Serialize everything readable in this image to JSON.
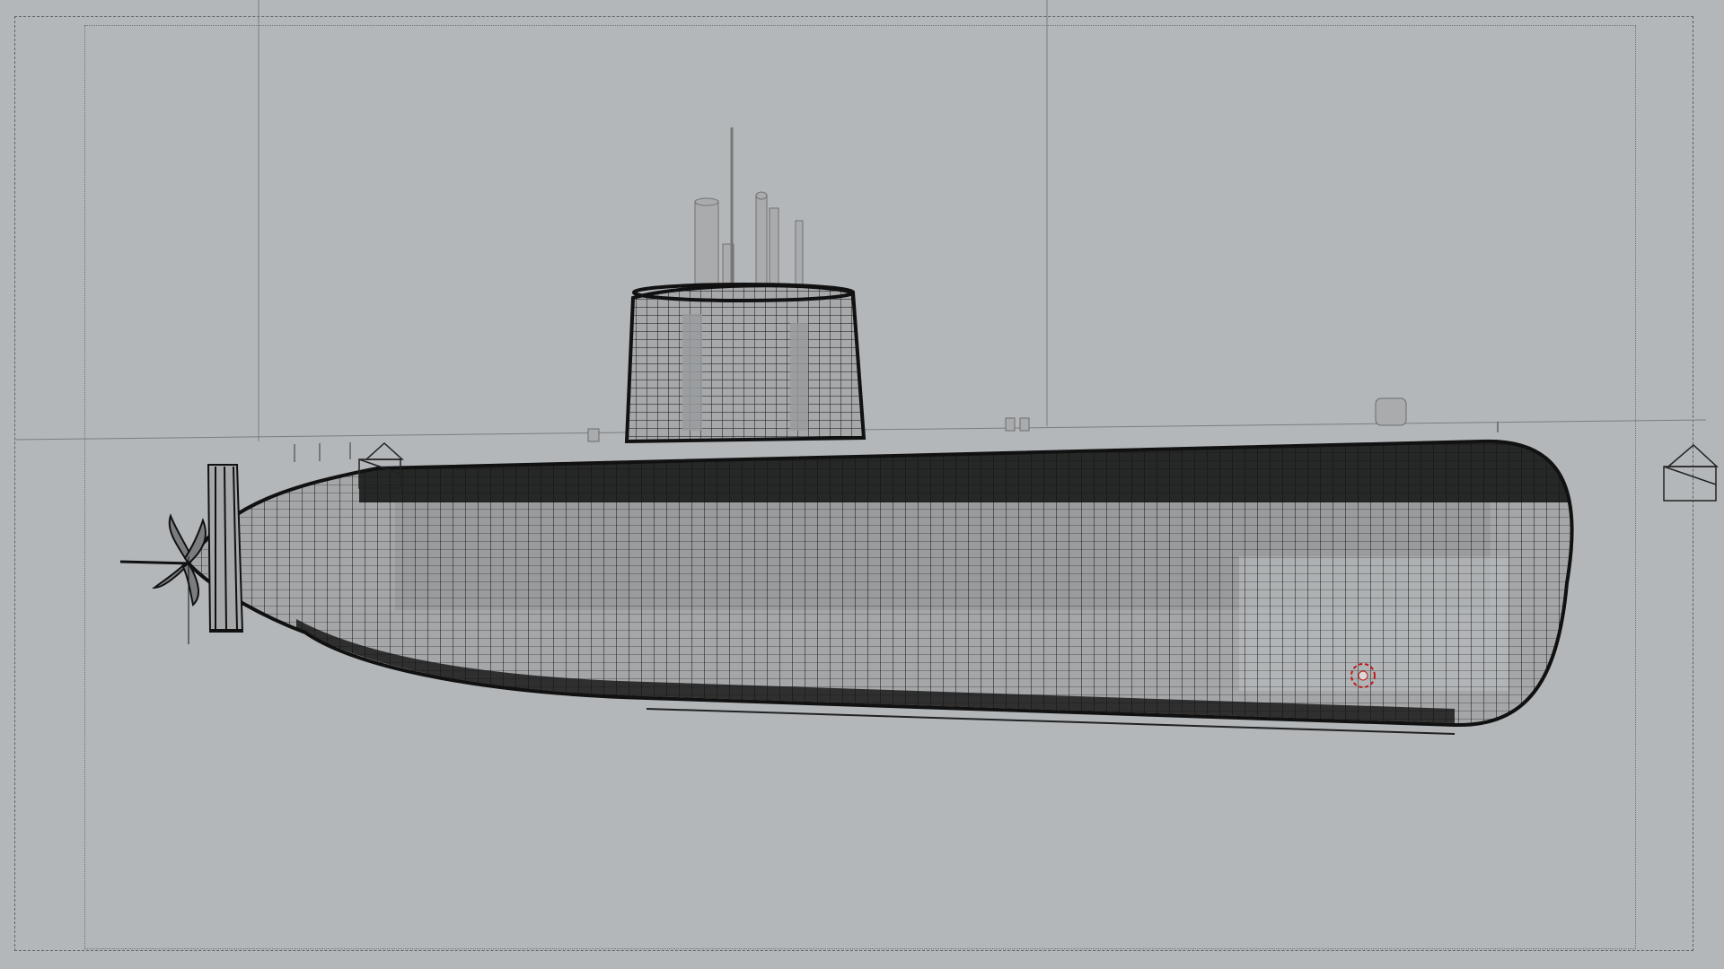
{
  "viewport": {
    "background_color": "#b3b7ba",
    "wire_color": "#111111",
    "solid_color": "#a8aaac",
    "highlight_color": "#c01818",
    "view": "side",
    "shading": "wireframe",
    "subject": "submarine"
  },
  "icons": {
    "camera_left": "camera-icon",
    "camera_right": "camera-icon",
    "selection_marker": "selection-marker-icon"
  }
}
